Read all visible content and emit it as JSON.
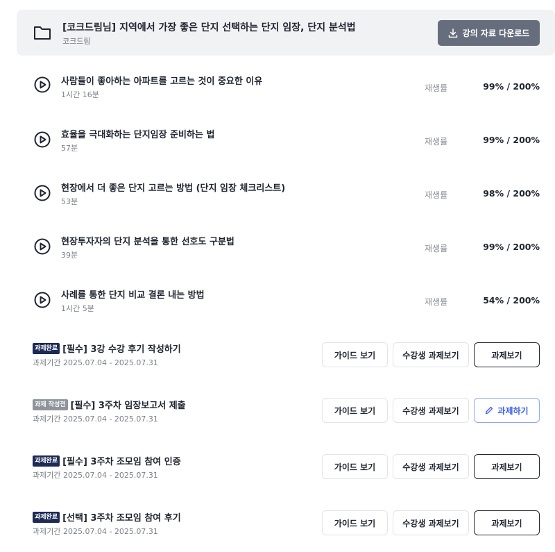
{
  "header": {
    "title": "[코크드림님] 지역에서 가장 좋은 단지 선택하는 단지 임장, 단지 분석법",
    "author": "코크드림",
    "download_label": "강의 자료 다운로드"
  },
  "lectures": [
    {
      "title": "사람들이 좋아하는 아파트를 고르는 것이 중요한 이유",
      "duration": "1시간 16분",
      "rate_label": "재생률",
      "rate": "99% / 200%"
    },
    {
      "title": "효율을 극대화하는 단지임장 준비하는 법",
      "duration": "57분",
      "rate_label": "재생률",
      "rate": "99% / 200%"
    },
    {
      "title": "현장에서 더 좋은 단지 고르는 방법 (단지 임장 체크리스트)",
      "duration": "53분",
      "rate_label": "재생률",
      "rate": "98% / 200%"
    },
    {
      "title": "현장투자자의 단지 분석을 통한 선호도 구분법",
      "duration": "39분",
      "rate_label": "재생률",
      "rate": "99% / 200%"
    },
    {
      "title": "사례를 통한 단지 비교 결론 내는 방법",
      "duration": "1시간 5분",
      "rate_label": "재생률",
      "rate": "54% / 200%"
    }
  ],
  "tasks": [
    {
      "badge": "과제완료",
      "title": "[필수] 3강 수강 후기 작성하기",
      "period": "과제기간 2025.07.04 - 2025.07.31",
      "guide_label": "가이드 보기",
      "peer_label": "수강생 과제보기",
      "action_label": "과제보기"
    },
    {
      "badge": "과제 작성전",
      "title": "[필수] 3주차 임장보고서 제출",
      "period": "과제기간 2025.07.04 - 2025.07.31",
      "guide_label": "가이드 보기",
      "peer_label": "수강생 과제보기",
      "action_label": "과제하기"
    },
    {
      "badge": "과제완료",
      "title": "[필수] 3주차 조모임 참여 인증",
      "period": "과제기간 2025.07.04 - 2025.07.31",
      "guide_label": "가이드 보기",
      "peer_label": "수강생 과제보기",
      "action_label": "과제보기"
    },
    {
      "badge": "과제완료",
      "title": "[선택] 3주차 조모임 참여 후기",
      "period": "과제기간 2025.07.04 - 2025.07.31",
      "guide_label": "가이드 보기",
      "peer_label": "수강생 과제보기",
      "action_label": "과제보기"
    }
  ],
  "icons": {
    "header": "folder-icon",
    "download": "download-icon",
    "lecture": "play-circle-icon",
    "do_task": "pencil-icon"
  },
  "colors": {
    "header_bg": "#f1f2f4",
    "download_button": "#666d7c",
    "badge_done": "#1d2a55",
    "badge_progress": "#8e939c",
    "accent_blue": "#3d5be8"
  }
}
